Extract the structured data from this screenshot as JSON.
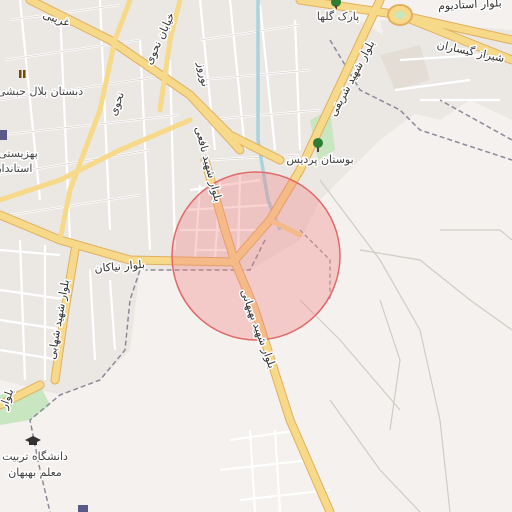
{
  "map": {
    "highlight_color": "#f08080",
    "road_labels": {
      "istadium": "بلوار استادیوم",
      "shiraz_gisaran": "شیراز گیساران",
      "gharibi": "غریبی",
      "nahavi": "نحوی",
      "nahavi2": "خیابان نحوی",
      "nowroz": "نوروز",
      "shahid_nafei": "بلوار شهید نافعی",
      "shahid_sharifi": "بلوار شهید شریفی",
      "niakan": "بلوار نیاکان",
      "shahid_behbahani": "بلوار شهید بهبهانی",
      "shahid_shahabi": "بلوار شهید شهابی",
      "bolvar": "بلوار"
    },
    "pois": [
      {
        "id": "park-gelha",
        "name": "پارک گلها",
        "icon": "tree-icon"
      },
      {
        "id": "bostan-pardis",
        "name": "بوستان پردیس",
        "icon": "tree-icon"
      },
      {
        "id": "dabestan-belal",
        "name": "دبستان بلال حبشی",
        "icon": "school-icon"
      },
      {
        "id": "behzisti",
        "name": "بهزیستی",
        "icon": "office-icon"
      },
      {
        "id": "ostandari",
        "name": "استانداری",
        "icon": "office-icon"
      },
      {
        "id": "university",
        "name": "دانشگاه تربیت",
        "name2": "معلم بهبهان",
        "icon": "graduation-cap-icon"
      }
    ]
  }
}
